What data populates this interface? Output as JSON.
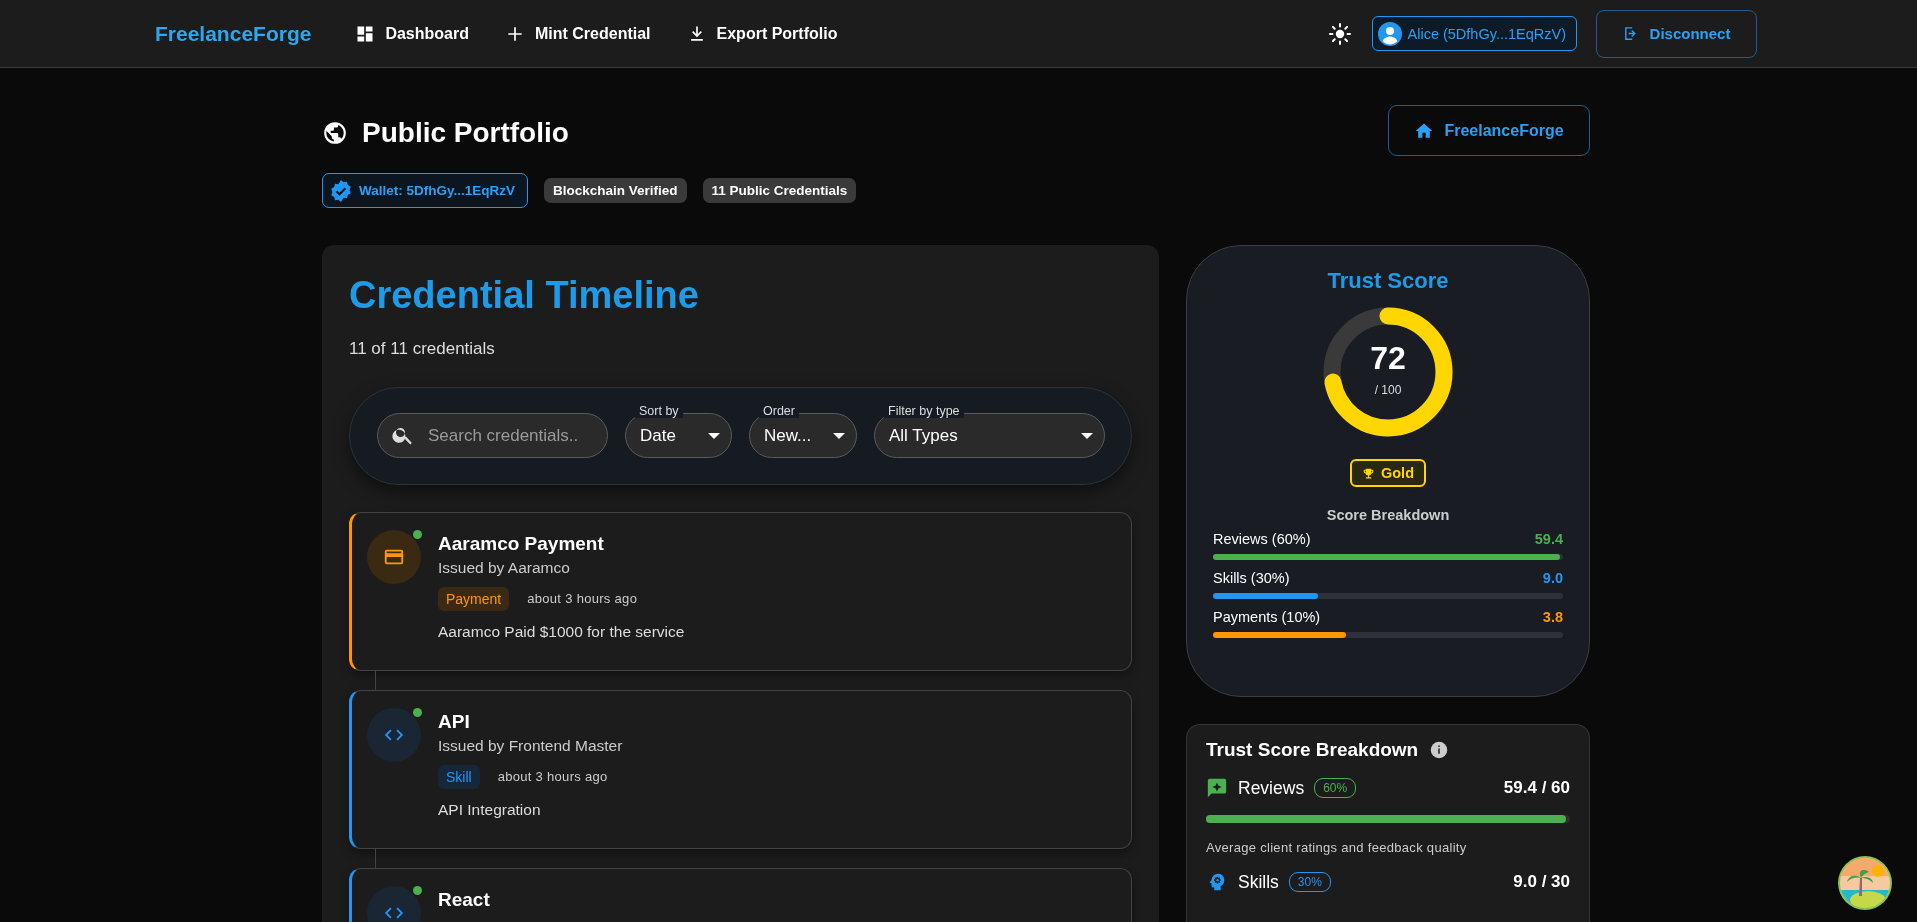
{
  "header": {
    "logo": "FreelanceForge",
    "nav": [
      {
        "kind": "dashboard",
        "label": "Dashboard"
      },
      {
        "kind": "mint",
        "label": "Mint Credential"
      },
      {
        "kind": "export",
        "label": "Export Portfolio"
      }
    ],
    "account": "Alice (5DfhGy...1EqRzV)",
    "disconnect": "Disconnect"
  },
  "page": {
    "title": "Public Portfolio",
    "home_button": "FreelanceForge",
    "chips": [
      {
        "kind": "wallet",
        "label": "Wallet: 5DfhGy...1EqRzV"
      },
      {
        "kind": "plain",
        "label": "Blockchain Verified"
      },
      {
        "kind": "plain",
        "label": "11 Public Credentials"
      }
    ]
  },
  "timeline": {
    "title": "Credential Timeline",
    "count": "11 of 11 credentials",
    "search": {
      "placeholder": "Search credentials.."
    },
    "selects": [
      {
        "label": "Sort by",
        "value": "Date"
      },
      {
        "label": "Order",
        "value": "New..."
      },
      {
        "label": "Filter by type",
        "value": "All Types"
      }
    ],
    "credentials": [
      {
        "kind": "payment",
        "verified": true,
        "title": "Aaramco Payment",
        "issuer": "Issued by Aaramco",
        "tag": "Payment",
        "time": "about 3 hours ago",
        "description": "Aaramco Paid $1000 for the service"
      },
      {
        "kind": "skill",
        "verified": true,
        "title": "API",
        "issuer": "Issued by Frontend Master",
        "tag": "Skill",
        "time": "about 3 hours ago",
        "description": "API Integration"
      },
      {
        "kind": "skill",
        "verified": true,
        "title": "React"
      }
    ]
  },
  "trust": {
    "title": "Trust Score",
    "score": "72",
    "out_of": "/ 100",
    "level": 0.72,
    "rank": "Gold",
    "breakdown_title": "Score Breakdown",
    "rows": [
      {
        "label": "Reviews (60%)",
        "value": "59.4",
        "level": 0.99,
        "color": "#4caf50"
      },
      {
        "label": "Skills (30%)",
        "value": "9.0",
        "level": 0.3,
        "color": "#2196f3"
      },
      {
        "label": "Payments (10%)",
        "value": "3.8",
        "level": 0.38,
        "color": "#ff9800"
      }
    ]
  },
  "breakdown": {
    "title": "Trust Score Breakdown",
    "items": [
      {
        "kind": "reviews",
        "label": "Reviews",
        "weight": "60%",
        "score": "59.4 / 60",
        "level": 0.99,
        "color": "#4caf50",
        "description": "Average client ratings and feedback quality"
      },
      {
        "kind": "skills",
        "label": "Skills",
        "weight": "30%",
        "score": "9.0 / 30",
        "color": "#2196f3"
      }
    ]
  }
}
